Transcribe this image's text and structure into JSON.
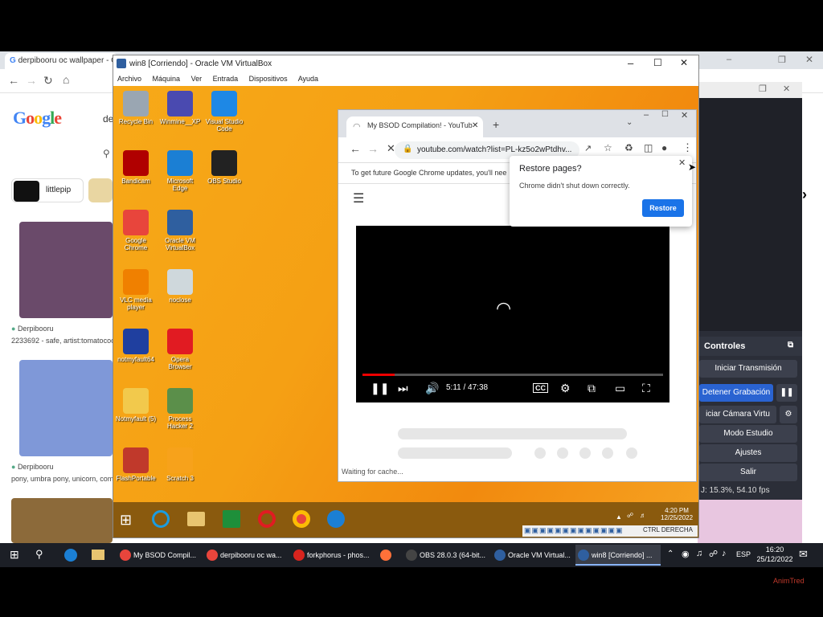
{
  "bg_browser": {
    "tab_title": "derpibooru oc wallpaper - G",
    "search_prefix": "de",
    "chip_label": "littlepip",
    "result1_source": "Derpibooru",
    "result1_caption": "2233692 - safe, artist:tomatococ",
    "result2_source": "Derpibooru",
    "result2_caption": "pony, umbra pony, unicorn, comic"
  },
  "obs": {
    "controls_header": "Controles",
    "buttons": [
      "Iniciar Transmisión",
      "Detener Grabación",
      "iciar Cámara Virtu",
      "Modo Estudio",
      "Ajustes",
      "Salir"
    ],
    "status": "J: 15.3%, 54.10 fps"
  },
  "vbox": {
    "title": "win8 [Corriendo] - Oracle VM VirtualBox",
    "menu": [
      "Archivo",
      "Máquina",
      "Ver",
      "Entrada",
      "Dispositivos",
      "Ayuda"
    ],
    "status_right": "CTRL DERECHA"
  },
  "desktop_icons": [
    {
      "label": "Recycle Bin",
      "color": "#9aa6b2"
    },
    {
      "label": "Winmine__XP",
      "color": "#4a4ab0"
    },
    {
      "label": "Visual Studio Code",
      "color": "#1e88e5"
    },
    {
      "label": "Bandicam",
      "color": "#b00000"
    },
    {
      "label": "Microsoft Edge",
      "color": "#1b7fd4"
    },
    {
      "label": "OBS Studio",
      "color": "#222222"
    },
    {
      "label": "Google Chrome",
      "color": "#e8453c"
    },
    {
      "label": "Oracle VM VirtualBox",
      "color": "#2f5f9f"
    },
    {
      "label": "VLC media player",
      "color": "#f08000"
    },
    {
      "label": "noclose",
      "color": "#cfd8dc"
    },
    {
      "label": "notmyfault64",
      "color": "#1f3f9f"
    },
    {
      "label": "Opera Browser",
      "color": "#e11b22"
    },
    {
      "label": "Notmyfault (5)",
      "color": "#f2c94c"
    },
    {
      "label": "Process Hacker 2",
      "color": "#5b8f4a"
    },
    {
      "label": "FlashPortable",
      "color": "#c0392b"
    },
    {
      "label": "Scratch 3",
      "color": "#f7a21b"
    }
  ],
  "chrome": {
    "tab_title": "My BSOD Compilation! - YouTub",
    "url": "youtube.com/watch?list=PL-kz5o2wPtdhv...",
    "info_bar": "To get future Google Chrome updates, you'll nee",
    "video_time": "5:11 / 47:38",
    "status": "Waiting for cache...",
    "video_progress_fraction": 0.108
  },
  "popup": {
    "title": "Restore pages?",
    "message": "Chrome didn't shut down correctly.",
    "button": "Restore"
  },
  "guest_taskbar": {
    "time": "4:20 PM",
    "date": "12/25/2022"
  },
  "host_taskbar": {
    "items": [
      {
        "label": "My BSOD Compil...",
        "color": "#e8453c"
      },
      {
        "label": "derpibooru oc wa...",
        "color": "#e8453c"
      },
      {
        "label": "forkphorus - phos...",
        "color": "#d8241e"
      },
      {
        "label": "",
        "color": "#ff7139"
      },
      {
        "label": "OBS 28.0.3 (64-bit...",
        "color": "#444444"
      },
      {
        "label": "Oracle VM Virtual...",
        "color": "#2f5f9f"
      },
      {
        "label": "win8 [Corriendo] ...",
        "color": "#2f5f9f"
      }
    ],
    "lang": "ESP",
    "time": "16:20",
    "date": "25/12/2022"
  },
  "watermark": "AnimTred"
}
